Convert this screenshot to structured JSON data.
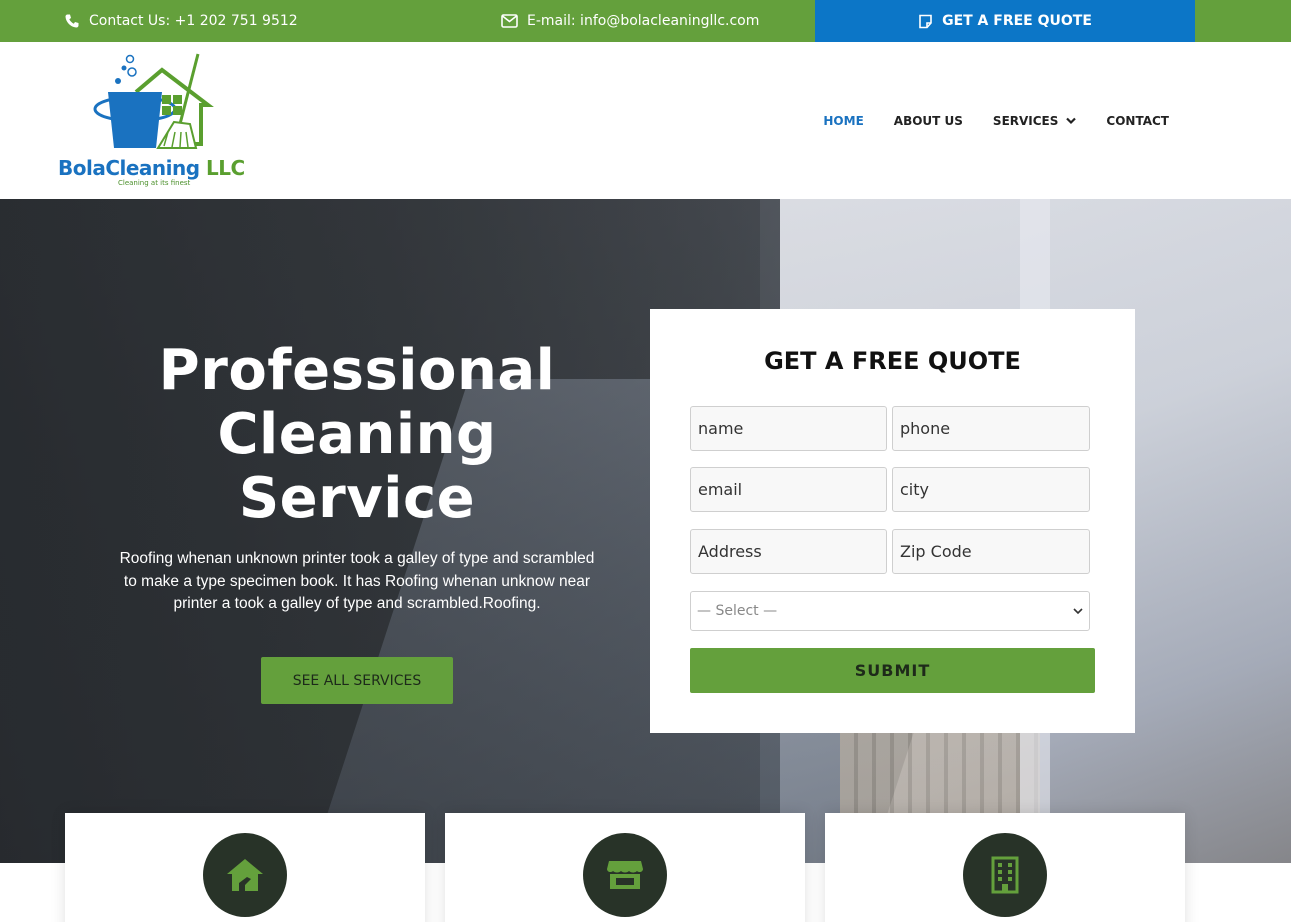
{
  "topbar": {
    "phone_text": "Contact Us: +1 202 751 9512",
    "email_text": "E-mail: info@bolacleaningllc.com",
    "quote_button": "GET A FREE QUOTE",
    "colors": {
      "bar": "#64a03c",
      "quote": "#0c76c7"
    }
  },
  "brand": {
    "name_part1": "BolaCleaning",
    "name_part2": "LLC",
    "tagline": "Cleaning at its finest"
  },
  "nav": {
    "items": [
      {
        "label": "HOME",
        "active": true
      },
      {
        "label": "ABOUT US"
      },
      {
        "label": "SERVICES",
        "has_dropdown": true
      },
      {
        "label": "CONTACT"
      }
    ]
  },
  "hero": {
    "title": "Professional Cleaning Service",
    "text": "Roofing whenan unknown printer took a galley of type and scrambled to make a type specimen book. It has Roofing whenan unknow near printer a took a galley of type and scrambled.Roofing.",
    "button": "SEE ALL SERVICES"
  },
  "quote_form": {
    "title": "GET A FREE QUOTE",
    "fields": {
      "name": "name",
      "phone": "phone",
      "email": "email",
      "city": "city",
      "address": "Address",
      "zip": "Zip Code"
    },
    "select_value": "— Select —",
    "submit": "SUBMIT"
  },
  "service_cards": [
    {
      "icon": "house-icon"
    },
    {
      "icon": "storefront-icon"
    },
    {
      "icon": "office-building-icon"
    }
  ]
}
